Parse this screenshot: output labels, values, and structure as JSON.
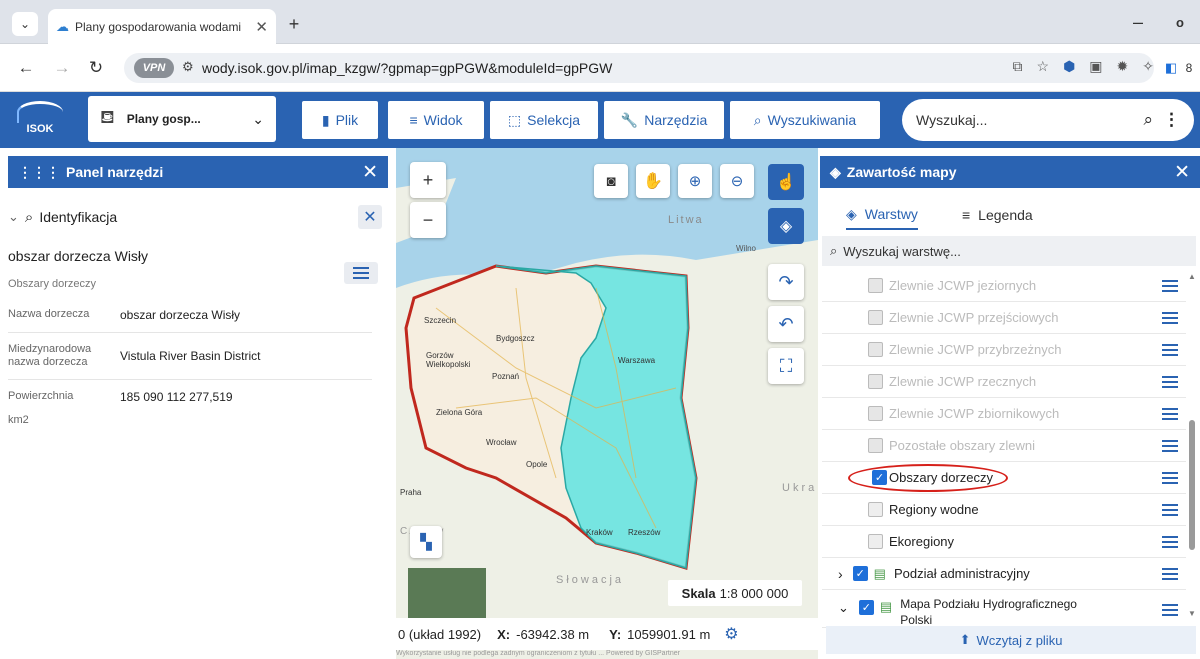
{
  "browser": {
    "tab_title": "Plany gospodarowania wodami",
    "tab_close": "✕",
    "new_tab": "+",
    "url": "wody.isok.gov.pl/imap_kzgw/?gpmap=gpPGW&moduleId=gpPGW",
    "vpn_badge": "VPN"
  },
  "header": {
    "logo_text": "ISOK",
    "module_label": "Plany gosp...",
    "menu": {
      "plik": "Plik",
      "widok": "Widok",
      "selekcja": "Selekcja",
      "narzedzia": "Narzędzia",
      "wyszukiwania": "Wyszukiwania"
    },
    "search_placeholder": "Wyszukaj..."
  },
  "left_panel": {
    "title": "Panel narzędzi",
    "section": "Identyfikacja",
    "feature_title": "obszar dorzecza Wisły",
    "feature_layer": "Obszary dorzeczy",
    "attributes": [
      {
        "key": "Nazwa dorzecza",
        "value": "obszar dorzecza Wisły"
      },
      {
        "key": "Miedzynarodowa nazwa dorzecza",
        "value": "Vistula River Basin District"
      },
      {
        "key": "Powierzchnia",
        "value": "185 090 112 277,519"
      }
    ],
    "unit": "km2"
  },
  "map": {
    "labels": {
      "litwa": "Litwa",
      "wilno": "Wilno",
      "szczecin": "Szczecin",
      "gorzow": "Gorzów Wielkopolski",
      "bydgoszcz": "Bydgoszcz",
      "poznan": "Poznań",
      "warszawa": "Warszawa",
      "zielona_gora": "Zielona Góra",
      "wroclaw": "Wrocław",
      "opole": "Opole",
      "praha": "Praha",
      "czechy": "Czechy",
      "krakow": "Kraków",
      "rzeszow": "Rzeszów",
      "slowacja": "Słowacja",
      "ukraina": "Ukra"
    },
    "scale_label": "Skala",
    "scale_value": "1:8 000 000",
    "crs_text": "0 (układ 1992)",
    "x_label": "X:",
    "x_value": "-63942.38 m",
    "y_label": "Y:",
    "y_value": "1059901.91 m",
    "footer": "Wykorzystanie usług nie podlega żadnym ograniczeniom z tytułu ... Powered by GISPartner"
  },
  "right_panel": {
    "title": "Zawartość mapy",
    "tab_layers": "Warstwy",
    "tab_legend": "Legenda",
    "layer_search_placeholder": "Wyszukaj warstwę...",
    "layers": [
      {
        "label": "Zlewnie JCWP jeziornych",
        "state": "disabled"
      },
      {
        "label": "Zlewnie JCWP przejściowych",
        "state": "disabled"
      },
      {
        "label": "Zlewnie JCWP przybrzeżnych",
        "state": "disabled"
      },
      {
        "label": "Zlewnie JCWP rzecznych",
        "state": "disabled"
      },
      {
        "label": "Zlewnie JCWP zbiornikowych",
        "state": "disabled"
      },
      {
        "label": "Pozostałe obszary zlewni",
        "state": "disabled"
      },
      {
        "label": "Obszary dorzeczy",
        "state": "checked"
      },
      {
        "label": "Regiony wodne",
        "state": "unchecked"
      },
      {
        "label": "Ekoregiony",
        "state": "unchecked"
      },
      {
        "label": "Podział administracyjny",
        "state": "group-checked"
      },
      {
        "label": "Mapa Podziału Hydrograficznego Polski",
        "state": "group-checked"
      }
    ],
    "load_file": "Wczytaj z pliku"
  },
  "colors": {
    "brand": "#2a63b2",
    "basin_fill": "#5fe3e0",
    "country_border": "#c0281e",
    "highlight_ring": "#d6201a"
  }
}
